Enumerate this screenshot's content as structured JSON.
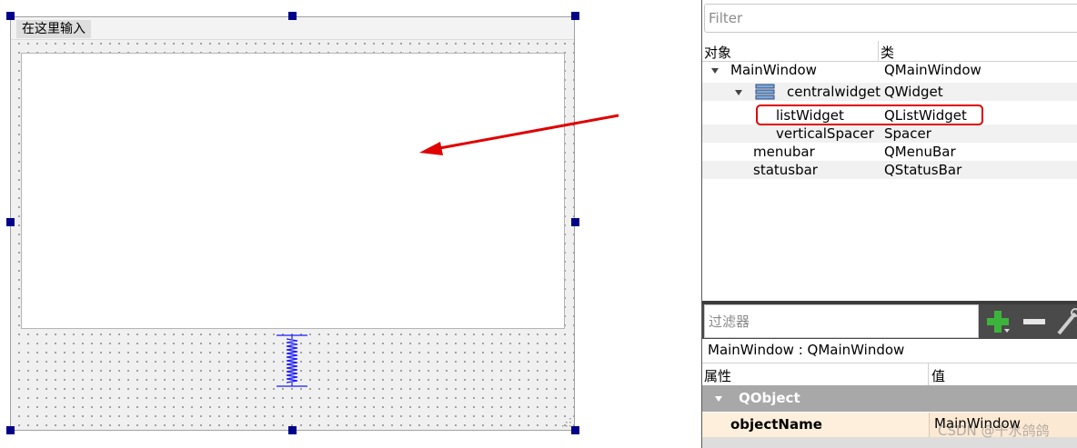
{
  "form": {
    "menu_item": "在这里输入"
  },
  "object_inspector": {
    "filter_placeholder": "Filter",
    "headers": {
      "object": "对象",
      "class": "类"
    },
    "rows": [
      {
        "object": "MainWindow",
        "class": "QMainWindow"
      },
      {
        "object": "centralwidget",
        "class": "QWidget"
      },
      {
        "object": "listWidget",
        "class": "QListWidget"
      },
      {
        "object": "verticalSpacer",
        "class": "Spacer"
      },
      {
        "object": "menubar",
        "class": "QMenuBar"
      },
      {
        "object": "statusbar",
        "class": "QStatusBar"
      }
    ]
  },
  "property_editor": {
    "filter_placeholder": "过滤器",
    "class_label": "MainWindow : QMainWindow",
    "headers": {
      "property": "属性",
      "value": "值"
    },
    "group": "QObject",
    "row": {
      "name": "objectName",
      "value": "MainWindow"
    }
  },
  "watermark": "CSDN @千水鸽鸽",
  "colors": {
    "annotation_red": "#e00000",
    "handle": "#00008b",
    "spacer_blue": "#1a1aff"
  }
}
